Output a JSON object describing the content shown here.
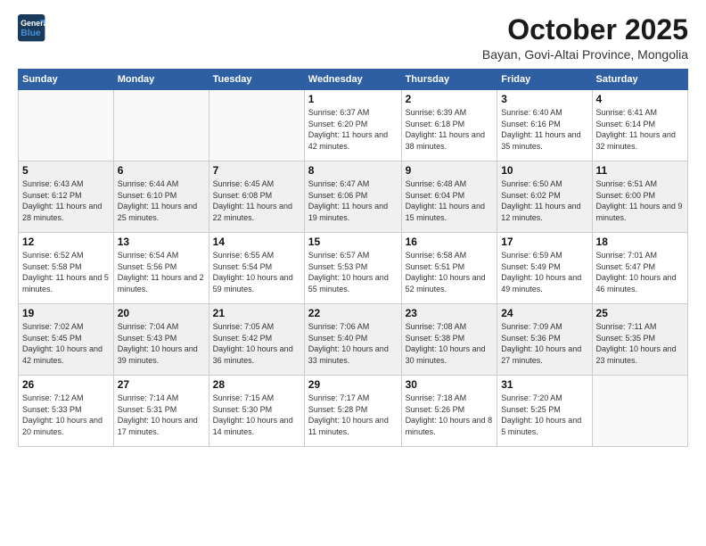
{
  "header": {
    "logo_line1": "General",
    "logo_line2": "Blue",
    "month": "October 2025",
    "location": "Bayan, Govi-Altai Province, Mongolia"
  },
  "days_of_week": [
    "Sunday",
    "Monday",
    "Tuesday",
    "Wednesday",
    "Thursday",
    "Friday",
    "Saturday"
  ],
  "weeks": [
    [
      {
        "day": "",
        "detail": ""
      },
      {
        "day": "",
        "detail": ""
      },
      {
        "day": "",
        "detail": ""
      },
      {
        "day": "1",
        "detail": "Sunrise: 6:37 AM\nSunset: 6:20 PM\nDaylight: 11 hours\nand 42 minutes."
      },
      {
        "day": "2",
        "detail": "Sunrise: 6:39 AM\nSunset: 6:18 PM\nDaylight: 11 hours\nand 38 minutes."
      },
      {
        "day": "3",
        "detail": "Sunrise: 6:40 AM\nSunset: 6:16 PM\nDaylight: 11 hours\nand 35 minutes."
      },
      {
        "day": "4",
        "detail": "Sunrise: 6:41 AM\nSunset: 6:14 PM\nDaylight: 11 hours\nand 32 minutes."
      }
    ],
    [
      {
        "day": "5",
        "detail": "Sunrise: 6:43 AM\nSunset: 6:12 PM\nDaylight: 11 hours\nand 28 minutes."
      },
      {
        "day": "6",
        "detail": "Sunrise: 6:44 AM\nSunset: 6:10 PM\nDaylight: 11 hours\nand 25 minutes."
      },
      {
        "day": "7",
        "detail": "Sunrise: 6:45 AM\nSunset: 6:08 PM\nDaylight: 11 hours\nand 22 minutes."
      },
      {
        "day": "8",
        "detail": "Sunrise: 6:47 AM\nSunset: 6:06 PM\nDaylight: 11 hours\nand 19 minutes."
      },
      {
        "day": "9",
        "detail": "Sunrise: 6:48 AM\nSunset: 6:04 PM\nDaylight: 11 hours\nand 15 minutes."
      },
      {
        "day": "10",
        "detail": "Sunrise: 6:50 AM\nSunset: 6:02 PM\nDaylight: 11 hours\nand 12 minutes."
      },
      {
        "day": "11",
        "detail": "Sunrise: 6:51 AM\nSunset: 6:00 PM\nDaylight: 11 hours\nand 9 minutes."
      }
    ],
    [
      {
        "day": "12",
        "detail": "Sunrise: 6:52 AM\nSunset: 5:58 PM\nDaylight: 11 hours\nand 5 minutes."
      },
      {
        "day": "13",
        "detail": "Sunrise: 6:54 AM\nSunset: 5:56 PM\nDaylight: 11 hours\nand 2 minutes."
      },
      {
        "day": "14",
        "detail": "Sunrise: 6:55 AM\nSunset: 5:54 PM\nDaylight: 10 hours\nand 59 minutes."
      },
      {
        "day": "15",
        "detail": "Sunrise: 6:57 AM\nSunset: 5:53 PM\nDaylight: 10 hours\nand 55 minutes."
      },
      {
        "day": "16",
        "detail": "Sunrise: 6:58 AM\nSunset: 5:51 PM\nDaylight: 10 hours\nand 52 minutes."
      },
      {
        "day": "17",
        "detail": "Sunrise: 6:59 AM\nSunset: 5:49 PM\nDaylight: 10 hours\nand 49 minutes."
      },
      {
        "day": "18",
        "detail": "Sunrise: 7:01 AM\nSunset: 5:47 PM\nDaylight: 10 hours\nand 46 minutes."
      }
    ],
    [
      {
        "day": "19",
        "detail": "Sunrise: 7:02 AM\nSunset: 5:45 PM\nDaylight: 10 hours\nand 42 minutes."
      },
      {
        "day": "20",
        "detail": "Sunrise: 7:04 AM\nSunset: 5:43 PM\nDaylight: 10 hours\nand 39 minutes."
      },
      {
        "day": "21",
        "detail": "Sunrise: 7:05 AM\nSunset: 5:42 PM\nDaylight: 10 hours\nand 36 minutes."
      },
      {
        "day": "22",
        "detail": "Sunrise: 7:06 AM\nSunset: 5:40 PM\nDaylight: 10 hours\nand 33 minutes."
      },
      {
        "day": "23",
        "detail": "Sunrise: 7:08 AM\nSunset: 5:38 PM\nDaylight: 10 hours\nand 30 minutes."
      },
      {
        "day": "24",
        "detail": "Sunrise: 7:09 AM\nSunset: 5:36 PM\nDaylight: 10 hours\nand 27 minutes."
      },
      {
        "day": "25",
        "detail": "Sunrise: 7:11 AM\nSunset: 5:35 PM\nDaylight: 10 hours\nand 23 minutes."
      }
    ],
    [
      {
        "day": "26",
        "detail": "Sunrise: 7:12 AM\nSunset: 5:33 PM\nDaylight: 10 hours\nand 20 minutes."
      },
      {
        "day": "27",
        "detail": "Sunrise: 7:14 AM\nSunset: 5:31 PM\nDaylight: 10 hours\nand 17 minutes."
      },
      {
        "day": "28",
        "detail": "Sunrise: 7:15 AM\nSunset: 5:30 PM\nDaylight: 10 hours\nand 14 minutes."
      },
      {
        "day": "29",
        "detail": "Sunrise: 7:17 AM\nSunset: 5:28 PM\nDaylight: 10 hours\nand 11 minutes."
      },
      {
        "day": "30",
        "detail": "Sunrise: 7:18 AM\nSunset: 5:26 PM\nDaylight: 10 hours\nand 8 minutes."
      },
      {
        "day": "31",
        "detail": "Sunrise: 7:20 AM\nSunset: 5:25 PM\nDaylight: 10 hours\nand 5 minutes."
      },
      {
        "day": "",
        "detail": ""
      }
    ]
  ]
}
